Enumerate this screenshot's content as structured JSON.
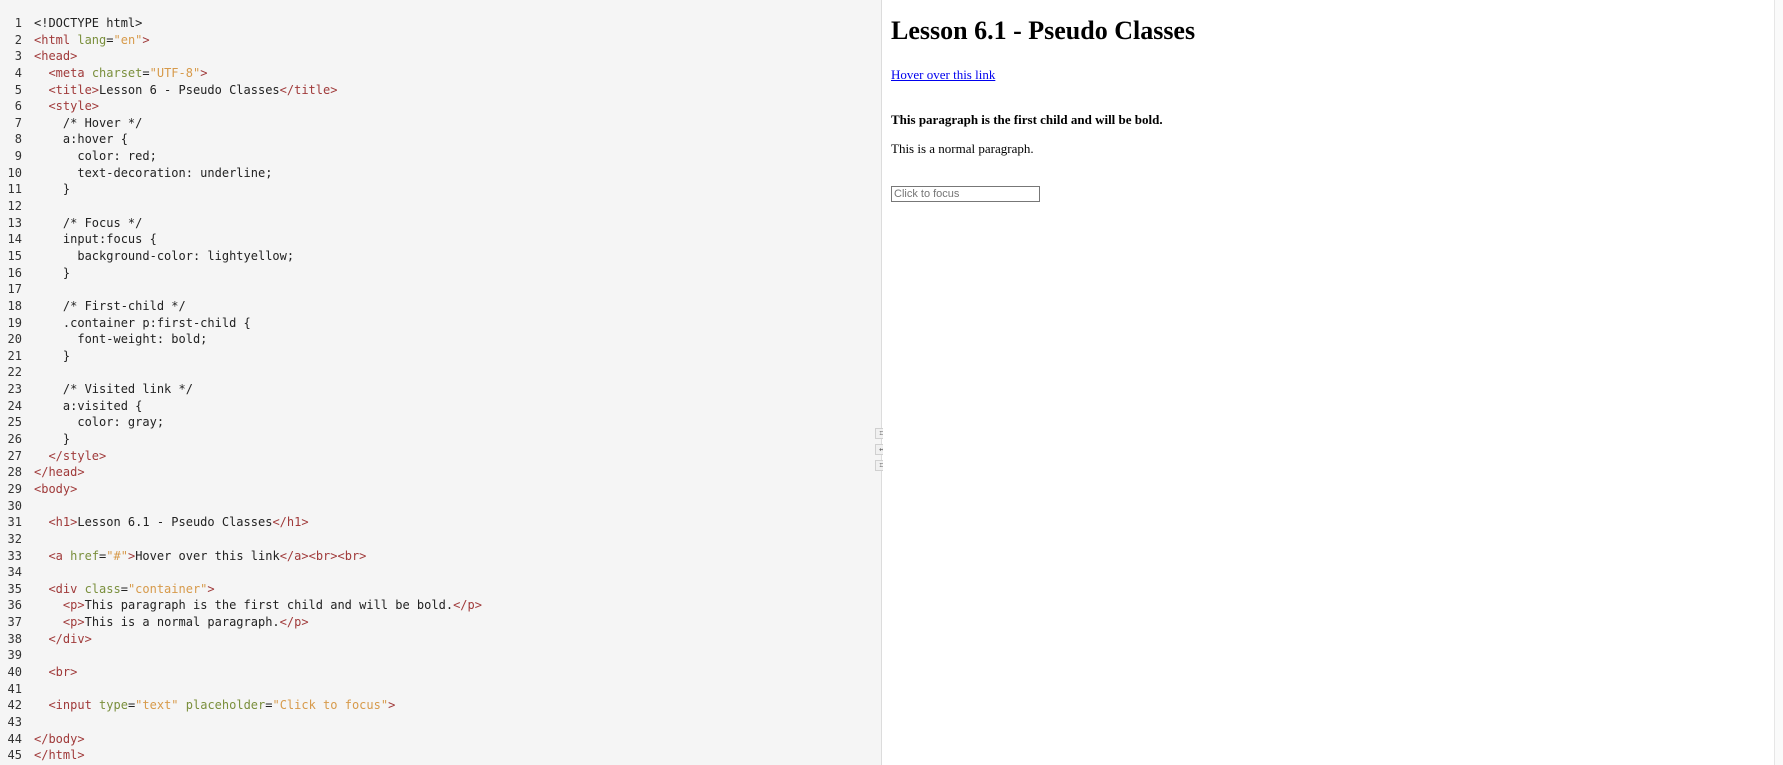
{
  "editor": {
    "lines": [
      {
        "n": "1",
        "parts": [
          [
            "txt",
            "<!DOCTYPE html>"
          ]
        ]
      },
      {
        "n": "2",
        "parts": [
          [
            "tag",
            "<html "
          ],
          [
            "attr",
            "lang"
          ],
          [
            "txt",
            "="
          ],
          [
            "val",
            "\"en\""
          ],
          [
            "tag",
            ">"
          ]
        ]
      },
      {
        "n": "3",
        "parts": [
          [
            "tag",
            "<head>"
          ]
        ]
      },
      {
        "n": "4",
        "parts": [
          [
            "txt",
            "  "
          ],
          [
            "tag",
            "<meta "
          ],
          [
            "attr",
            "charset"
          ],
          [
            "txt",
            "="
          ],
          [
            "val",
            "\"UTF-8\""
          ],
          [
            "tag",
            ">"
          ]
        ]
      },
      {
        "n": "5",
        "parts": [
          [
            "txt",
            "  "
          ],
          [
            "tag",
            "<title>"
          ],
          [
            "txt",
            "Lesson 6 - Pseudo Classes"
          ],
          [
            "tag",
            "</title>"
          ]
        ]
      },
      {
        "n": "6",
        "parts": [
          [
            "txt",
            "  "
          ],
          [
            "tag",
            "<style>"
          ]
        ]
      },
      {
        "n": "7",
        "parts": [
          [
            "txt",
            "    /* Hover */"
          ]
        ]
      },
      {
        "n": "8",
        "parts": [
          [
            "txt",
            "    a:hover {"
          ]
        ]
      },
      {
        "n": "9",
        "parts": [
          [
            "txt",
            "      color: red;"
          ]
        ]
      },
      {
        "n": "10",
        "parts": [
          [
            "txt",
            "      text-decoration: underline;"
          ]
        ]
      },
      {
        "n": "11",
        "parts": [
          [
            "txt",
            "    }"
          ]
        ]
      },
      {
        "n": "12",
        "parts": [
          [
            "txt",
            ""
          ]
        ]
      },
      {
        "n": "13",
        "parts": [
          [
            "txt",
            "    /* Focus */"
          ]
        ]
      },
      {
        "n": "14",
        "parts": [
          [
            "txt",
            "    input:focus {"
          ]
        ]
      },
      {
        "n": "15",
        "parts": [
          [
            "txt",
            "      background-color: lightyellow;"
          ]
        ]
      },
      {
        "n": "16",
        "parts": [
          [
            "txt",
            "    }"
          ]
        ]
      },
      {
        "n": "17",
        "parts": [
          [
            "txt",
            ""
          ]
        ]
      },
      {
        "n": "18",
        "parts": [
          [
            "txt",
            "    /* First-child */"
          ]
        ]
      },
      {
        "n": "19",
        "parts": [
          [
            "txt",
            "    .container p:first-child {"
          ]
        ]
      },
      {
        "n": "20",
        "parts": [
          [
            "txt",
            "      font-weight: bold;"
          ]
        ]
      },
      {
        "n": "21",
        "parts": [
          [
            "txt",
            "    }"
          ]
        ]
      },
      {
        "n": "22",
        "parts": [
          [
            "txt",
            ""
          ]
        ]
      },
      {
        "n": "23",
        "parts": [
          [
            "txt",
            "    /* Visited link */"
          ]
        ]
      },
      {
        "n": "24",
        "parts": [
          [
            "txt",
            "    a:visited {"
          ]
        ]
      },
      {
        "n": "25",
        "parts": [
          [
            "txt",
            "      color: gray;"
          ]
        ]
      },
      {
        "n": "26",
        "parts": [
          [
            "txt",
            "    }"
          ]
        ]
      },
      {
        "n": "27",
        "parts": [
          [
            "txt",
            "  "
          ],
          [
            "tag",
            "</style>"
          ]
        ]
      },
      {
        "n": "28",
        "parts": [
          [
            "tag",
            "</head>"
          ]
        ]
      },
      {
        "n": "29",
        "parts": [
          [
            "tag",
            "<body>"
          ]
        ]
      },
      {
        "n": "30",
        "parts": [
          [
            "txt",
            ""
          ]
        ]
      },
      {
        "n": "31",
        "parts": [
          [
            "txt",
            "  "
          ],
          [
            "tag",
            "<h1>"
          ],
          [
            "txt",
            "Lesson 6.1 - Pseudo Classes"
          ],
          [
            "tag",
            "</h1>"
          ]
        ]
      },
      {
        "n": "32",
        "parts": [
          [
            "txt",
            ""
          ]
        ]
      },
      {
        "n": "33",
        "parts": [
          [
            "txt",
            "  "
          ],
          [
            "tag",
            "<a "
          ],
          [
            "attr",
            "href"
          ],
          [
            "txt",
            "="
          ],
          [
            "val",
            "\"#\""
          ],
          [
            "tag",
            ">"
          ],
          [
            "txt",
            "Hover over this link"
          ],
          [
            "tag",
            "</a><br><br>"
          ]
        ]
      },
      {
        "n": "34",
        "parts": [
          [
            "txt",
            ""
          ]
        ]
      },
      {
        "n": "35",
        "parts": [
          [
            "txt",
            "  "
          ],
          [
            "tag",
            "<div "
          ],
          [
            "attr",
            "class"
          ],
          [
            "txt",
            "="
          ],
          [
            "val",
            "\"container\""
          ],
          [
            "tag",
            ">"
          ]
        ]
      },
      {
        "n": "36",
        "parts": [
          [
            "txt",
            "    "
          ],
          [
            "tag",
            "<p>"
          ],
          [
            "txt",
            "This paragraph is the first child and will be bold."
          ],
          [
            "tag",
            "</p>"
          ]
        ]
      },
      {
        "n": "37",
        "parts": [
          [
            "txt",
            "    "
          ],
          [
            "tag",
            "<p>"
          ],
          [
            "txt",
            "This is a normal paragraph."
          ],
          [
            "tag",
            "</p>"
          ]
        ]
      },
      {
        "n": "38",
        "parts": [
          [
            "txt",
            "  "
          ],
          [
            "tag",
            "</div>"
          ]
        ]
      },
      {
        "n": "39",
        "parts": [
          [
            "txt",
            ""
          ]
        ]
      },
      {
        "n": "40",
        "parts": [
          [
            "txt",
            "  "
          ],
          [
            "tag",
            "<br>"
          ]
        ]
      },
      {
        "n": "41",
        "parts": [
          [
            "txt",
            ""
          ]
        ]
      },
      {
        "n": "42",
        "parts": [
          [
            "txt",
            "  "
          ],
          [
            "tag",
            "<input "
          ],
          [
            "attr",
            "type"
          ],
          [
            "txt",
            "="
          ],
          [
            "val",
            "\"text\""
          ],
          [
            "txt",
            " "
          ],
          [
            "attr",
            "placeholder"
          ],
          [
            "txt",
            "="
          ],
          [
            "val",
            "\"Click to focus\""
          ],
          [
            "tag",
            ">"
          ]
        ]
      },
      {
        "n": "43",
        "parts": [
          [
            "txt",
            ""
          ]
        ]
      },
      {
        "n": "44",
        "parts": [
          [
            "tag",
            "</body>"
          ]
        ]
      },
      {
        "n": "45",
        "parts": [
          [
            "tag",
            "</html>"
          ]
        ]
      }
    ]
  },
  "splitter": {
    "top_icon": "⌗",
    "middle_icon": "↔",
    "bottom_icon": "⌗"
  },
  "preview": {
    "heading": "Lesson 6.1 - Pseudo Classes",
    "link_text": "Hover over this link",
    "first_paragraph": "This paragraph is the first child and will be bold.",
    "normal_paragraph": "This is a normal paragraph.",
    "input_placeholder": "Click to focus"
  }
}
